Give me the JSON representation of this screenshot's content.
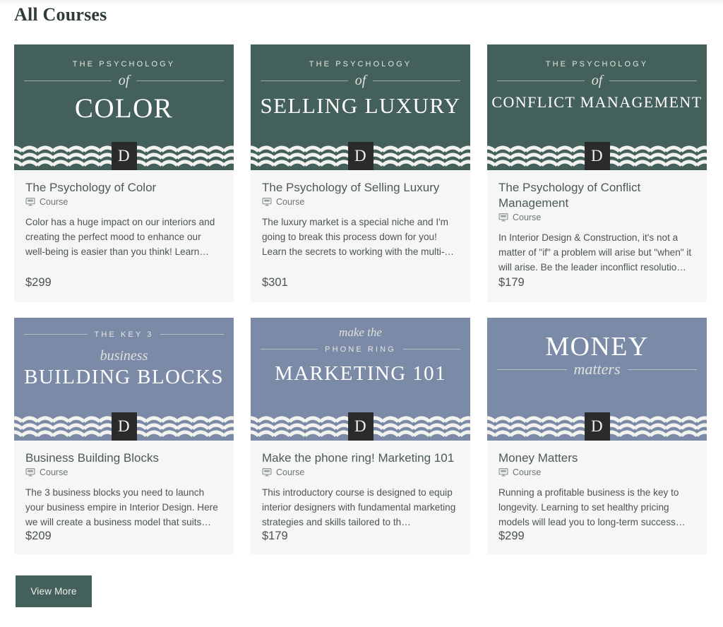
{
  "page": {
    "title": "All Courses",
    "background": "#ffffff"
  },
  "colors": {
    "green_banner": "#44605b",
    "blue_banner": "#7b8aa7",
    "card_body": "#f6f6f4",
    "logo_badge": "#2b2b2b",
    "title_text": "#4b5a5a",
    "button": "#44605b"
  },
  "logo": {
    "letter": "D",
    "name": "brand-logo-d"
  },
  "meta_icon": {
    "name": "presentation-screen-icon",
    "label": "Course"
  },
  "courses": [
    {
      "banner": {
        "theme": "green",
        "eyebrow": "THE PSYCHOLOGY",
        "script": "of",
        "main": "COLOR",
        "main_size": "39px",
        "layout": "eyebrow-rule-main"
      },
      "title": "The Psychology of Color",
      "type_label": "Course",
      "description": "Color has a huge impact on our interiors and creating the perfect mood to enhance our well-being is easier than you think! Learn…",
      "price": "$299"
    },
    {
      "banner": {
        "theme": "green",
        "eyebrow": "THE PSYCHOLOGY",
        "script": "of",
        "main": "SELLING LUXURY",
        "main_size": "31px",
        "layout": "eyebrow-rule-main"
      },
      "title": "The Psychology of Selling Luxury",
      "type_label": "Course",
      "description": "The luxury market is a special niche and I'm going to break this process down for you! Learn the secrets to working with the multi-…",
      "price": "$301"
    },
    {
      "banner": {
        "theme": "green",
        "eyebrow": "THE PSYCHOLOGY",
        "script": "of",
        "main": "CONFLICT MANAGEMENT",
        "main_size": "22px",
        "layout": "eyebrow-rule-main"
      },
      "title": "The Psychology of Conflict Management",
      "type_label": "Course",
      "description": "In Interior Design & Construction, it's not a matter of \"if\" a problem will arise but \"when\" it will arise. Be the leader inconflict resolutio…",
      "price": "$179"
    },
    {
      "banner": {
        "theme": "blue",
        "eyebrow": "THE KEY 3",
        "script": "business",
        "main": "BUILDING BLOCKS",
        "main_size": "29px",
        "layout": "rule-eyebrow-script-main"
      },
      "title": "Business Building Blocks",
      "type_label": "Course",
      "description": "The 3 business blocks you need to launch your business empire in Interior Design. Here we will create a business model that suits…",
      "price": "$209"
    },
    {
      "banner": {
        "theme": "blue",
        "eyebrow": "PHONE RING",
        "script": "make the",
        "main": "MARKETING 101",
        "main_size": "29px",
        "layout": "script-rule-eyebrow-main"
      },
      "title": "Make the phone ring! Marketing 101",
      "type_label": "Course",
      "description": "This introductory course is designed to equip interior designers with fundamental marketing strategies and skills tailored to th…",
      "price": "$179"
    },
    {
      "banner": {
        "theme": "blue",
        "eyebrow": "",
        "script": "matters",
        "main": "MONEY",
        "main_size": "38px",
        "layout": "main-rule-script"
      },
      "title": "Money Matters",
      "type_label": "Course",
      "description": "Running a profitable business is the key to longevity.  Learning to set healthy pricing models will lead you to long-term success…",
      "price": "$299"
    }
  ],
  "view_more_button": {
    "label": "View More"
  }
}
